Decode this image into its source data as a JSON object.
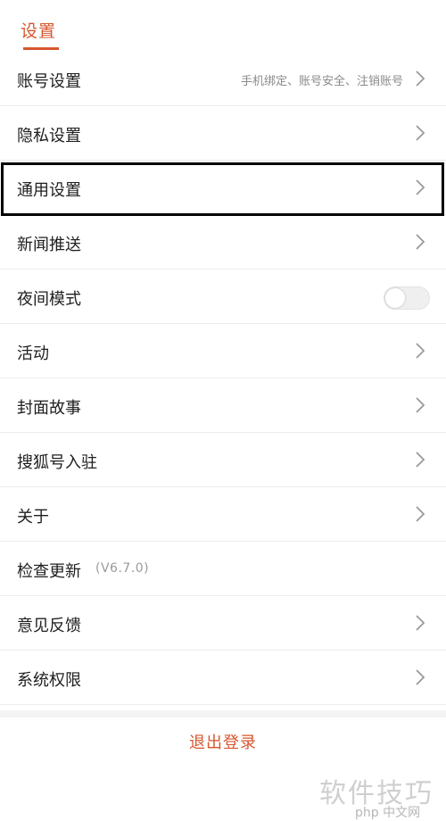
{
  "header": {
    "title": "设置"
  },
  "rows": [
    {
      "label": "账号设置",
      "secondary": "手机绑定、账号安全、注销账号"
    },
    {
      "label": "隐私设置"
    },
    {
      "label": "通用设置"
    },
    {
      "label": "新闻推送"
    },
    {
      "label": "夜间模式"
    },
    {
      "label": "活动"
    },
    {
      "label": "封面故事"
    },
    {
      "label": "搜狐号入驻"
    },
    {
      "label": "关于"
    },
    {
      "label": "检查更新",
      "version": "(V6.7.0)"
    },
    {
      "label": "意见反馈"
    },
    {
      "label": "系统权限"
    }
  ],
  "night_mode": {
    "enabled": false
  },
  "logout": {
    "label": "退出登录"
  },
  "watermark": {
    "main": "软件技巧",
    "site": "php 中文网"
  },
  "colors": {
    "accent": "#d7562f",
    "highlight_border": "#000000"
  },
  "icons": {
    "chevron": "chevron-right-icon"
  }
}
